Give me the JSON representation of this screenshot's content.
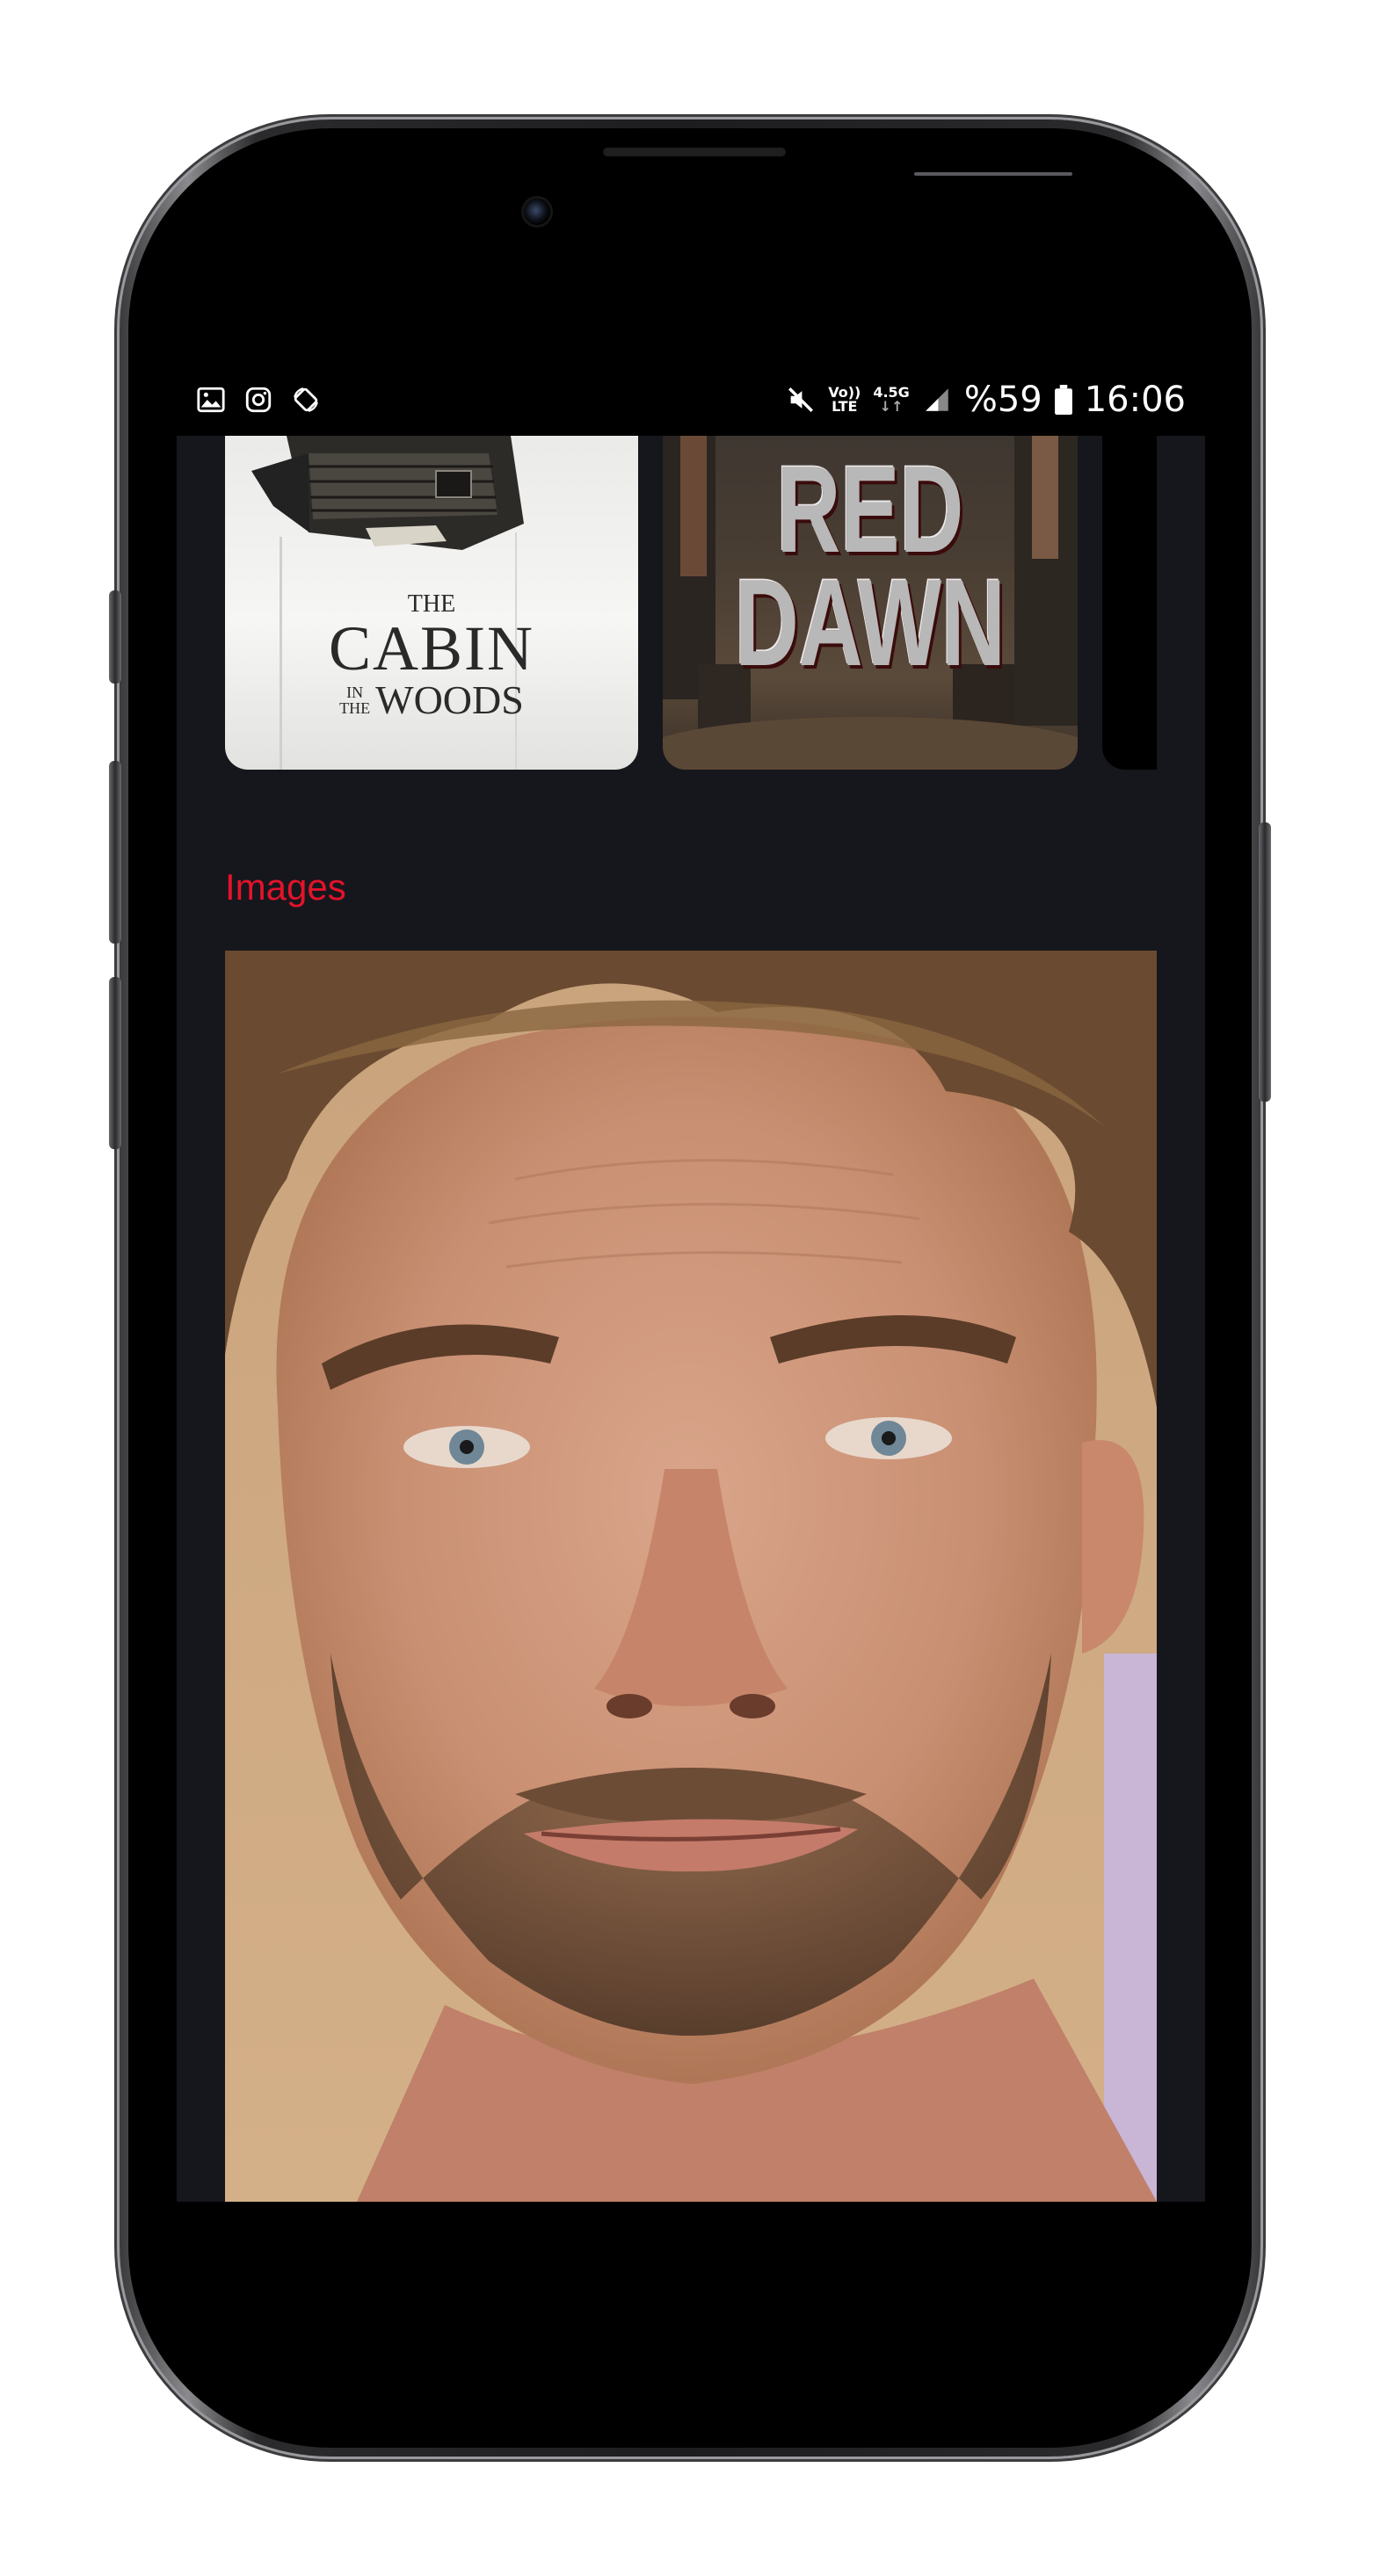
{
  "status_bar": {
    "left_icons": [
      "gallery-icon",
      "instagram-icon",
      "screen-rotate-icon"
    ],
    "mute_icon": "mute-icon",
    "volte_label_top": "Vo))",
    "volte_label_bottom": "LTE",
    "network_label": "4.5G",
    "network_arrows": "↓↑",
    "battery_percent": "%59",
    "time": "16:06"
  },
  "posters": [
    {
      "title_line1": "THE",
      "title_line2": "CABIN",
      "title_line3": "IN",
      "title_line4": "THE",
      "title_line5": "WOODS"
    },
    {
      "title_line1": "RED",
      "title_line2": "DAWN"
    },
    {}
  ],
  "sections": {
    "images_title": "Images"
  },
  "colors": {
    "accent": "#e3132b",
    "screen_background": "#16171c",
    "frame": "#1d1d1f"
  }
}
